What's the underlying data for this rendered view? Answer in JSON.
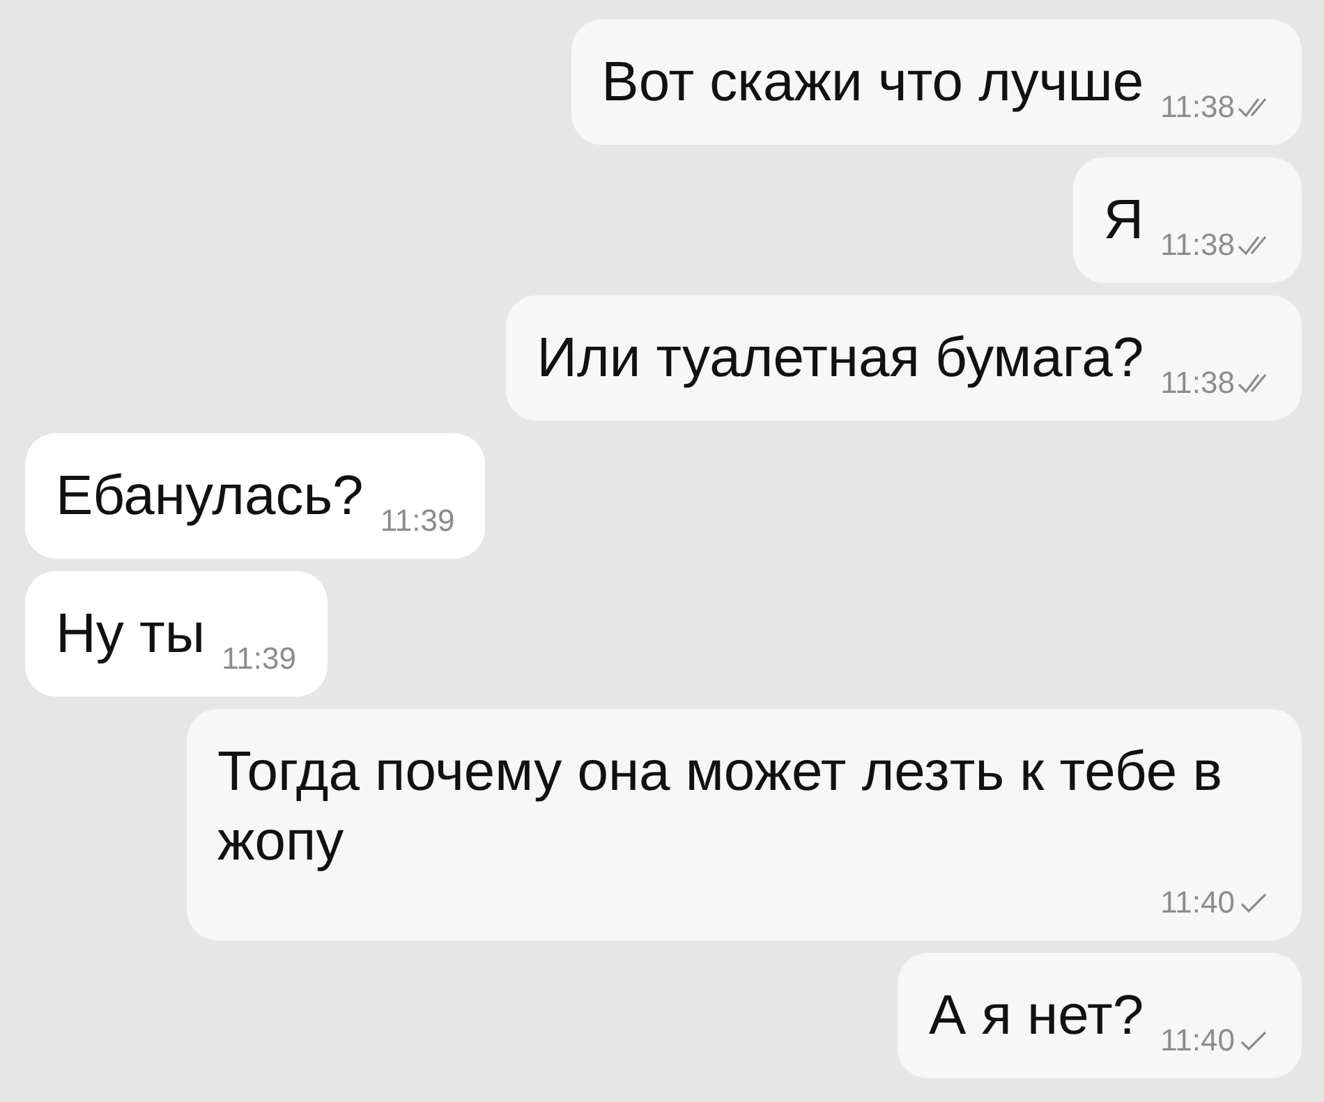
{
  "messages": [
    {
      "kind": "outgoing",
      "text": "Вот скажи что лучше",
      "time": "11:38",
      "read": true
    },
    {
      "kind": "outgoing",
      "text": "Я",
      "time": "11:38",
      "read": true
    },
    {
      "kind": "outgoing",
      "text": "Или туалетная бумага?",
      "time": "11:38",
      "read": true
    },
    {
      "kind": "incoming",
      "text": "Ебанулась?",
      "time": "11:39"
    },
    {
      "kind": "incoming",
      "text": "Ну ты",
      "time": "11:39"
    },
    {
      "kind": "outgoing",
      "text": "Тогда почему она может лезть к тебе в жопу",
      "time": "11:40",
      "read": false
    },
    {
      "kind": "outgoing",
      "text": "А я нет?",
      "time": "11:40",
      "read": false
    }
  ]
}
